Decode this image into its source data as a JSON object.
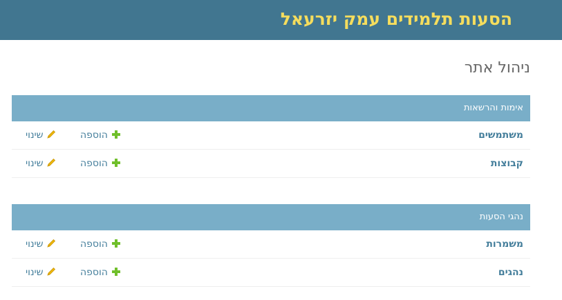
{
  "header": {
    "site_title": "הסעות תלמידים עמק יזרעאל"
  },
  "page": {
    "title": "ניהול אתר"
  },
  "modules": [
    {
      "caption": "אימות והרשאות",
      "models": [
        {
          "name": "משתמשים",
          "add_label": "הוספה",
          "change_label": "שינוי"
        },
        {
          "name": "קבוצות",
          "add_label": "הוספה",
          "change_label": "שינוי"
        }
      ]
    },
    {
      "caption": "נהגי הסעות",
      "models": [
        {
          "name": "משמרות",
          "add_label": "הוספה",
          "change_label": "שינוי"
        },
        {
          "name": "נהגים",
          "add_label": "הוספה",
          "change_label": "שינוי"
        }
      ]
    }
  ],
  "colors": {
    "header_bg": "#417690",
    "site_title": "#f5dd5d",
    "module_caption_bg": "#79aec8",
    "link": "#447e9b",
    "add_icon": "#70bf2b",
    "change_icon": "#efb80b"
  },
  "icons": {
    "add": "plus-icon",
    "change": "pencil-icon"
  }
}
